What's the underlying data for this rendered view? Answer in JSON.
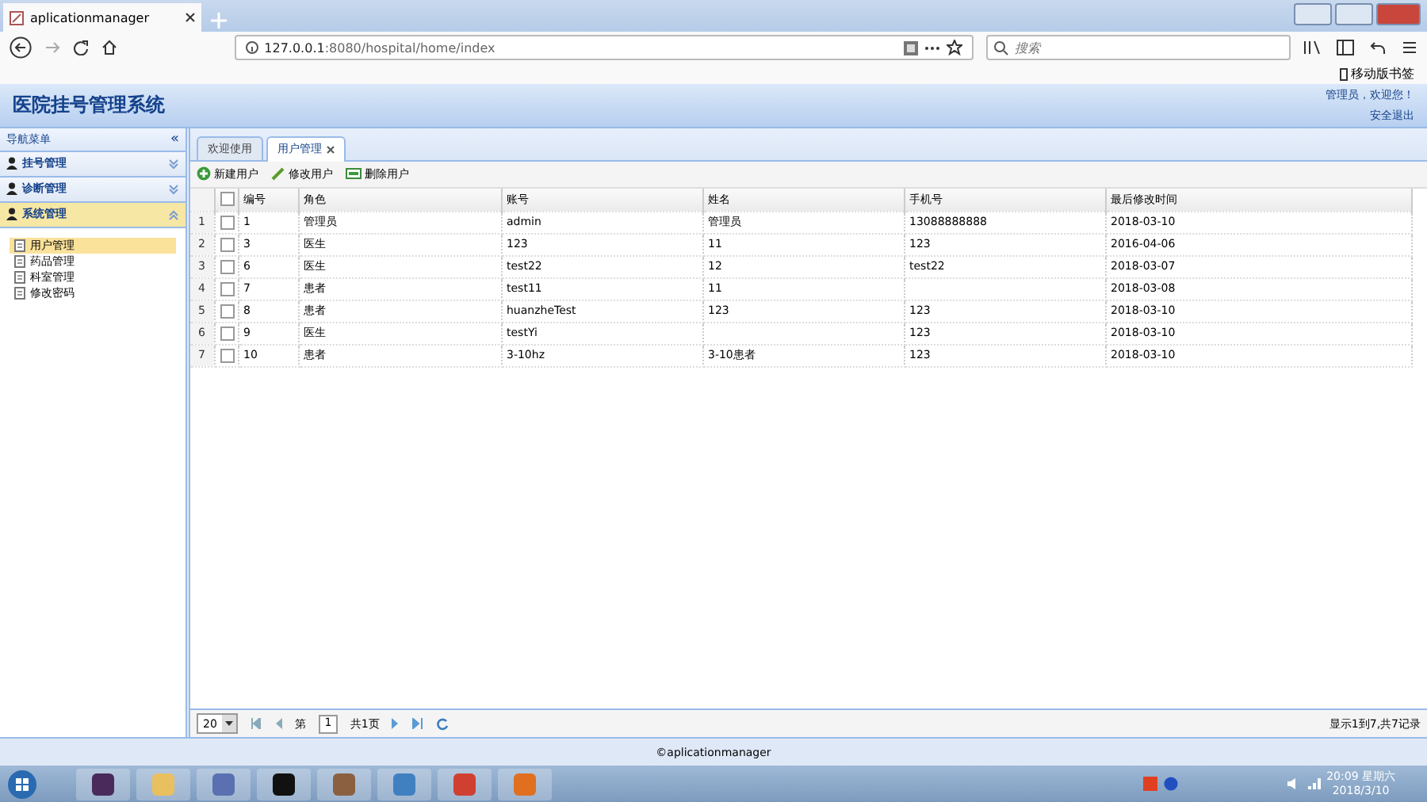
{
  "browser": {
    "tab_title": "aplicationmanager",
    "url_host": "127.0.0.1",
    "url_rest": ":8080/hospital/home/index",
    "search": {
      "placeholder": "搜索"
    },
    "bookmarks_label": "移动版书签"
  },
  "header": {
    "title": "医院挂号管理系统",
    "welcome": "管理员，欢迎您！",
    "logout": "安全退出"
  },
  "sidebar": {
    "title": "导航菜单",
    "collapse": "«",
    "sections": [
      {
        "label": "挂号管理",
        "expanded": false
      },
      {
        "label": "诊断管理",
        "expanded": false
      },
      {
        "label": "系统管理",
        "expanded": true,
        "children": [
          {
            "label": "用户管理",
            "selected": true
          },
          {
            "label": "药品管理",
            "selected": false
          },
          {
            "label": "科室管理",
            "selected": false
          },
          {
            "label": "修改密码",
            "selected": false
          }
        ]
      }
    ]
  },
  "tabs": [
    {
      "label": "欢迎使用",
      "selected": false,
      "closable": false
    },
    {
      "label": "用户管理",
      "selected": true,
      "closable": true
    }
  ],
  "toolbar": [
    {
      "kind": "add",
      "label": "新建用户"
    },
    {
      "kind": "edit",
      "label": "修改用户"
    },
    {
      "kind": "remove",
      "label": "删除用户"
    }
  ],
  "table": {
    "all_checked": false,
    "columns": [
      "编号",
      "角色",
      "账号",
      "姓名",
      "手机号",
      "最后修改时间"
    ],
    "rows": [
      {
        "n": "1",
        "checked": false,
        "cells": [
          "1",
          "管理员",
          "admin",
          "管理员",
          "13088888888",
          "2018-03-10"
        ]
      },
      {
        "n": "2",
        "checked": false,
        "cells": [
          "3",
          "医生",
          "123",
          "11",
          "123",
          "2016-04-06"
        ]
      },
      {
        "n": "3",
        "checked": false,
        "cells": [
          "6",
          "医生",
          "test22",
          "12",
          "test22",
          "2018-03-07"
        ]
      },
      {
        "n": "4",
        "checked": false,
        "cells": [
          "7",
          "患者",
          "test11",
          "11",
          "",
          "2018-03-08"
        ]
      },
      {
        "n": "5",
        "checked": false,
        "cells": [
          "8",
          "患者",
          "huanzheTest",
          "123",
          "123",
          "2018-03-10"
        ]
      },
      {
        "n": "6",
        "checked": false,
        "cells": [
          "9",
          "医生",
          "testYi",
          "",
          "123",
          "2018-03-10"
        ]
      },
      {
        "n": "7",
        "checked": false,
        "cells": [
          "10",
          "患者",
          "3-10hz",
          "3-10患者",
          "123",
          "2018-03-10"
        ]
      }
    ]
  },
  "pager": {
    "page_size": "20",
    "page_prefix": "第",
    "page": "1",
    "page_suffix": "共1页",
    "summary": "显示1到7,共7记录"
  },
  "footer": "©aplicationmanager",
  "taskbar": {
    "time": "20:09 星期六",
    "date": "2018/3/10"
  }
}
